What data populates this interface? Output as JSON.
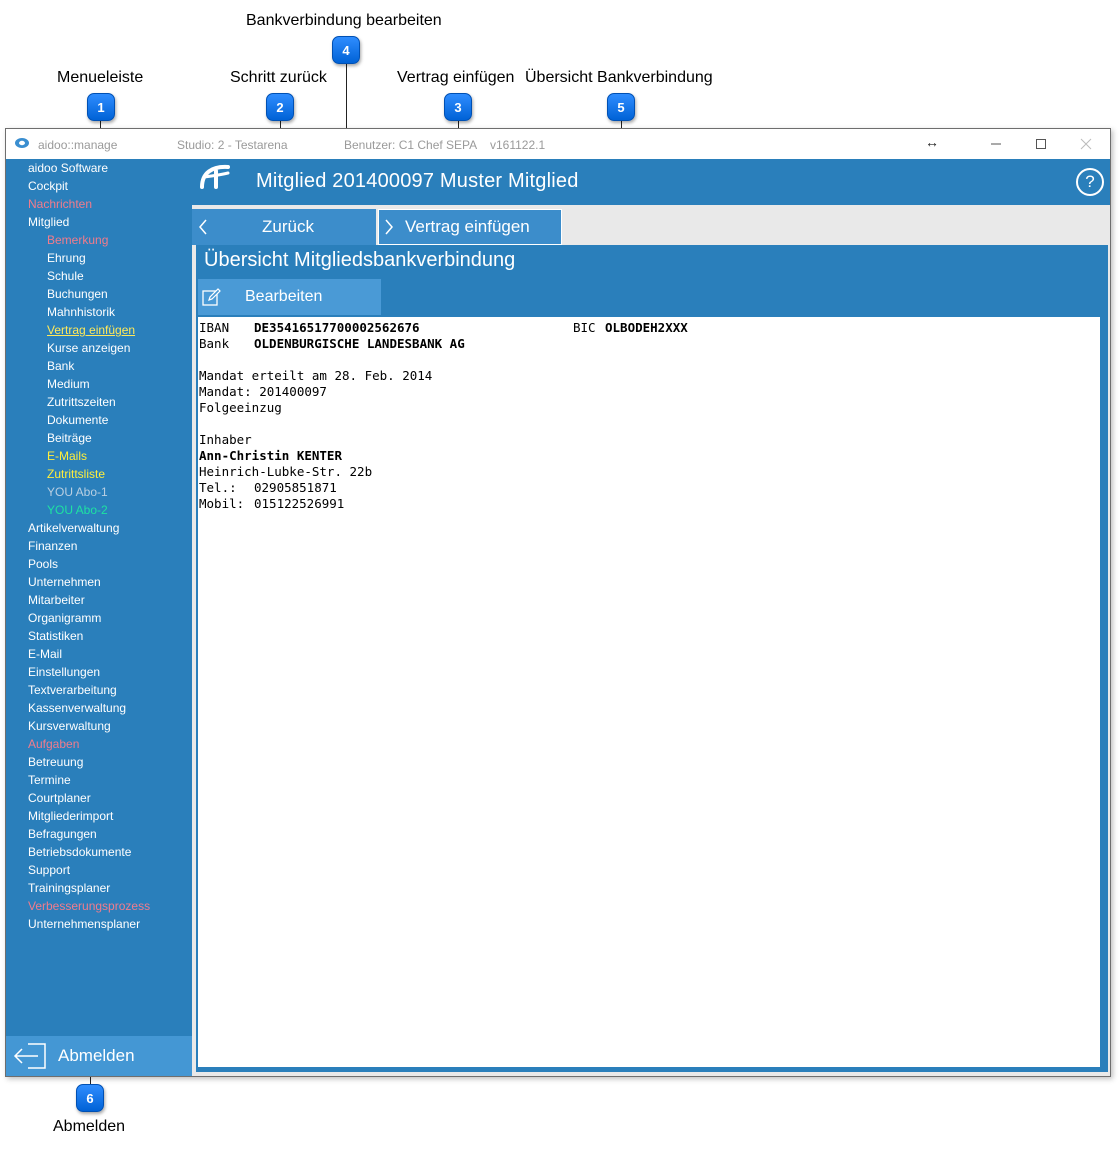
{
  "callouts": [
    {
      "number": "1",
      "label": "Menueleiste"
    },
    {
      "number": "2",
      "label": "Schritt zurück"
    },
    {
      "number": "3",
      "label": "Vertrag einfügen"
    },
    {
      "number": "4",
      "label": "Bankverbindung bearbeiten"
    },
    {
      "number": "5",
      "label": "Übersicht Bankverbindung"
    },
    {
      "number": "6",
      "label": "Abmelden"
    }
  ],
  "titlebar": {
    "app": "aidoo::manage",
    "studio": "Studio: 2 - Testarena",
    "user": "Benutzer: C1 Chef",
    "mode": "SEPA",
    "version": "v161122.1",
    "resize_glyph": "↔"
  },
  "sidebar": {
    "items": [
      {
        "label": "aidoo Software",
        "level": 0,
        "color": "white"
      },
      {
        "label": "Cockpit",
        "level": 0,
        "color": "white"
      },
      {
        "label": "Nachrichten",
        "level": 0,
        "color": "pink"
      },
      {
        "label": "Mitglied",
        "level": 0,
        "color": "white"
      },
      {
        "label": "Bemerkung",
        "level": 1,
        "color": "pink"
      },
      {
        "label": "Ehrung",
        "level": 1,
        "color": "white"
      },
      {
        "label": "Schule",
        "level": 1,
        "color": "white"
      },
      {
        "label": "Buchungen",
        "level": 1,
        "color": "white"
      },
      {
        "label": "Mahnhistorik",
        "level": 1,
        "color": "white"
      },
      {
        "label": "Vertrag einfügen",
        "level": 1,
        "color": "yellowu"
      },
      {
        "label": "Kurse anzeigen",
        "level": 1,
        "color": "white"
      },
      {
        "label": "Bank",
        "level": 1,
        "color": "white"
      },
      {
        "label": "Medium",
        "level": 1,
        "color": "white"
      },
      {
        "label": "Zutrittszeiten",
        "level": 1,
        "color": "white"
      },
      {
        "label": "Dokumente",
        "level": 1,
        "color": "white"
      },
      {
        "label": "Beiträge",
        "level": 1,
        "color": "white"
      },
      {
        "label": "E-Mails",
        "level": 1,
        "color": "yellow"
      },
      {
        "label": "Zutrittsliste",
        "level": 1,
        "color": "yellow"
      },
      {
        "label": "YOU Abo-1",
        "level": 1,
        "color": "grey"
      },
      {
        "label": "YOU Abo-2",
        "level": 1,
        "color": "green"
      },
      {
        "label": "Artikelverwaltung",
        "level": 0,
        "color": "white"
      },
      {
        "label": "Finanzen",
        "level": 0,
        "color": "white"
      },
      {
        "label": "Pools",
        "level": 0,
        "color": "white"
      },
      {
        "label": "Unternehmen",
        "level": 0,
        "color": "white"
      },
      {
        "label": "Mitarbeiter",
        "level": 0,
        "color": "white"
      },
      {
        "label": "Organigramm",
        "level": 0,
        "color": "white"
      },
      {
        "label": "Statistiken",
        "level": 0,
        "color": "white"
      },
      {
        "label": "E-Mail",
        "level": 0,
        "color": "white"
      },
      {
        "label": "Einstellungen",
        "level": 0,
        "color": "white"
      },
      {
        "label": "Textverarbeitung",
        "level": 0,
        "color": "white"
      },
      {
        "label": "Kassenverwaltung",
        "level": 0,
        "color": "white"
      },
      {
        "label": "Kursverwaltung",
        "level": 0,
        "color": "white"
      },
      {
        "label": "Aufgaben",
        "level": 0,
        "color": "pink"
      },
      {
        "label": "Betreuung",
        "level": 0,
        "color": "white"
      },
      {
        "label": "Termine",
        "level": 0,
        "color": "white"
      },
      {
        "label": "Courtplaner",
        "level": 0,
        "color": "white"
      },
      {
        "label": "Mitgliederimport",
        "level": 0,
        "color": "white"
      },
      {
        "label": "Befragungen",
        "level": 0,
        "color": "white"
      },
      {
        "label": "Betriebsdokumente",
        "level": 0,
        "color": "white"
      },
      {
        "label": "Support",
        "level": 0,
        "color": "white"
      },
      {
        "label": "Trainingsplaner",
        "level": 0,
        "color": "white"
      },
      {
        "label": "Verbesserungsprozess",
        "level": 0,
        "color": "pink"
      },
      {
        "label": "Unternehmensplaner",
        "level": 0,
        "color": "white"
      }
    ],
    "logout_label": "Abmelden"
  },
  "header": {
    "title": "Mitglied  201400097 Muster Mitglied",
    "help": "?"
  },
  "nav": {
    "back_label": "Zurück",
    "insert_contract_label": "Vertrag einfügen"
  },
  "panel": {
    "title": "Übersicht Mitgliedsbankverbindung",
    "edit_label": "Bearbeiten"
  },
  "bank": {
    "iban_label": "IBAN",
    "iban": "DE35416517700002562676",
    "bic_label": "BIC",
    "bic": "OLBODEH2XXX",
    "bank_label": "Bank",
    "bank_name": "OLDENBURGISCHE LANDESBANK AG",
    "mandate_date": "Mandat erteilt am 28. Feb. 2014",
    "mandate": "Mandat: 201400097",
    "collection": "Folgeeinzug",
    "holder_label": "Inhaber",
    "holder_name": "Ann-Christin KENTER",
    "street": "Heinrich-Lubke-Str. 22b",
    "tel_label": "Tel.:",
    "tel": "02905851871",
    "mobile_label": "Mobil:",
    "mobile": "015122526991"
  },
  "colors": {
    "primary": "#2a7fbb",
    "button": "#3c8dcb",
    "badge": "#1a7df0",
    "pink": "#f17c8c",
    "yellow": "#ffee3b",
    "green": "#1ee2a2"
  }
}
